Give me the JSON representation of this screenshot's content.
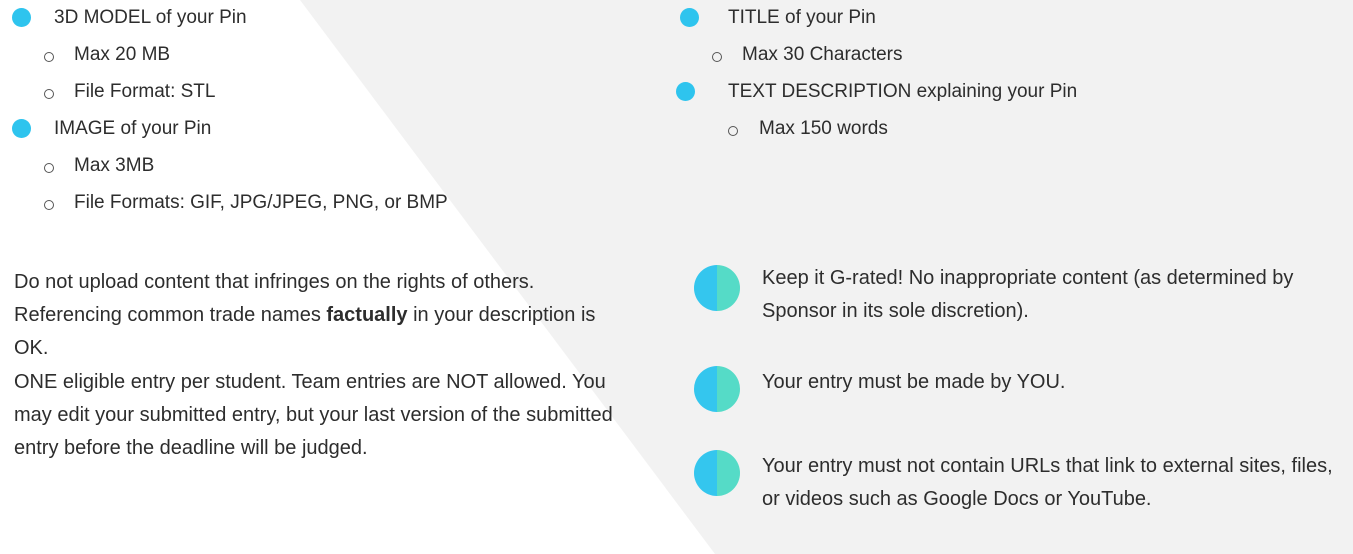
{
  "colors": {
    "bullet": "#2ec4ee",
    "half_dot_left": "#34c6ee",
    "half_dot_right": "#55dbc7",
    "panel_background": "#f2f2f2",
    "text": "#2d2d2d"
  },
  "requirements_left": [
    {
      "label": "3D MODEL of your Pin",
      "sub": [
        "Max 20 MB",
        "File Format: STL"
      ]
    },
    {
      "label": "IMAGE of your Pin",
      "sub": [
        "Max 3MB",
        "File Formats: GIF, JPG/JPEG, PNG, or BMP"
      ]
    }
  ],
  "requirements_right": [
    {
      "label": "TITLE of your Pin",
      "sub": [
        "Max 30 Characters"
      ]
    },
    {
      "label": "TEXT DESCRIPTION explaining your Pin",
      "sub": [
        "Max 150 words"
      ]
    }
  ],
  "rights_paragraph": {
    "before": "Do not upload content that infringes on the rights of others. Referencing common trade names ",
    "emphasis": "factually",
    "after": " in your description is OK."
  },
  "entry_paragraph": "ONE eligible entry per student. Team entries are NOT allowed. You may edit your submitted entry, but your last version of the submitted entry before the deadline will be judged.",
  "rules": [
    {
      "text": "Keep it G-rated! No inappropriate content (as determined by Sponsor in its sole discretion)."
    },
    {
      "text": "Your entry must be made by YOU."
    },
    {
      "text": "Your entry must not contain URLs that link to external sites, files, or videos such as Google Docs or YouTube."
    }
  ]
}
